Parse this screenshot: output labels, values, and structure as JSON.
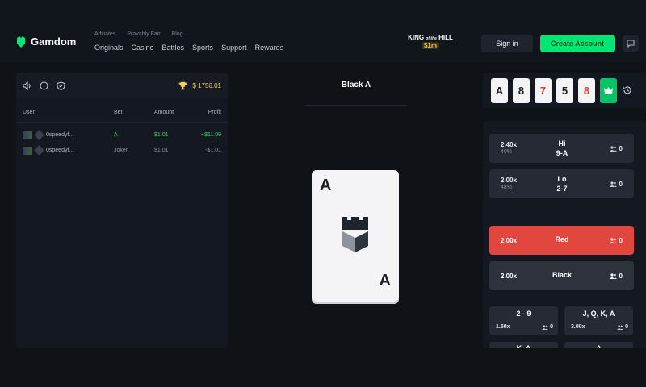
{
  "brand": {
    "name": "Gamdom"
  },
  "nav": {
    "sub": [
      "Affiliates",
      "Provably Fair",
      "Blog"
    ],
    "main": [
      "Originals",
      "Casino",
      "Battles",
      "Sports",
      "Support",
      "Rewards"
    ]
  },
  "king": {
    "title_line1": "KING",
    "title_line2": "HILL",
    "of_the": "of the",
    "amount": "$1m"
  },
  "auth": {
    "signin": "Sign in",
    "create": "Create Account"
  },
  "balance": "$ 1756.01",
  "table": {
    "headers": [
      "User",
      "Bet",
      "Amount",
      "Profit"
    ],
    "rows": [
      {
        "user": "0speedyf...",
        "bet": "A",
        "amount": "$1.01",
        "profit": "+$11.09"
      },
      {
        "user": "0speedyf...",
        "bet": "Joker",
        "amount": "$1.01",
        "profit": "-$1.01"
      }
    ]
  },
  "current": {
    "title": "Black A",
    "card_rank": "A"
  },
  "history": [
    "A",
    "8",
    "7",
    "5",
    "8"
  ],
  "hilo": [
    {
      "mult": "2.40x",
      "pct": "40%",
      "name": "Hi",
      "range": "9-A",
      "count": "0"
    },
    {
      "mult": "2.00x",
      "pct": "48%",
      "name": "Lo",
      "range": "2-7",
      "count": "0"
    }
  ],
  "colors": [
    {
      "mult": "2.00x",
      "name": "Red",
      "count": "0"
    },
    {
      "mult": "2.00x",
      "name": "Black",
      "count": "0"
    }
  ],
  "groups": [
    {
      "name": "2 - 9",
      "mult": "1.50x",
      "count": "0"
    },
    {
      "name": "J, Q, K, A",
      "mult": "3.00x",
      "count": "0"
    }
  ],
  "groups_partial": [
    "K, A",
    "A"
  ],
  "accent": {
    "green": "#00e676",
    "red": "#e2473f",
    "gold": "#f5cf5b"
  }
}
